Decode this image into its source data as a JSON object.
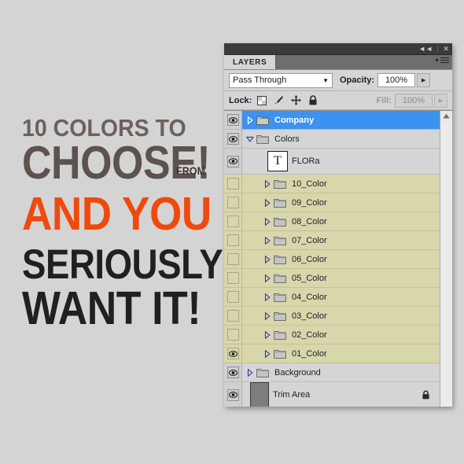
{
  "canvas": {
    "background_color": "#d4d4d4"
  },
  "poster": {
    "line1": "10 COLORS TO",
    "line2": "CHOOSE!",
    "line2_suffix": "FROM",
    "line3": "AND YOU",
    "line4": "SERIOUSLY",
    "line5": "WANT IT!",
    "colors": {
      "line1": "#6d615c",
      "line2": "#5d524e",
      "line2_suffix": "#3b3432",
      "line3": "#ef4a0e",
      "line4": "#211f1f",
      "line5": "#211f1f"
    }
  },
  "panel": {
    "titlebar": {
      "collapse_icon": "◄◄",
      "separator": "|",
      "close_icon": "✕"
    },
    "tab_label": "LAYERS",
    "menu_icon": "panel-menu-icon",
    "blend": {
      "mode": "Pass Through",
      "dropdown_arrow": "▼",
      "opacity_label": "Opacity:",
      "opacity_value": "100%",
      "stepper_arrow": "▶"
    },
    "lock": {
      "label": "Lock:",
      "icons": [
        "transparency-lock-icon",
        "brush-lock-icon",
        "move-lock-icon",
        "all-lock-icon"
      ],
      "fill_label": "Fill:",
      "fill_value": "100%",
      "fill_stepper_arrow": "▶"
    },
    "scrollbar": {
      "up_arrow": "▲"
    },
    "selected_row_color": "#3b92f0",
    "color_group_row_color": "#d8d6ab"
  },
  "layers": [
    {
      "name": "Company",
      "type": "group",
      "visible": true,
      "expanded": false,
      "selected": true,
      "indent": 0,
      "highlight": "selected"
    },
    {
      "name": "Colors",
      "type": "group",
      "visible": true,
      "expanded": true,
      "selected": false,
      "indent": 0,
      "highlight": "none"
    },
    {
      "name": "FLORa",
      "type": "text",
      "visible": true,
      "expanded": null,
      "selected": false,
      "indent": 1,
      "highlight": "none",
      "thumbnail": "T"
    },
    {
      "name": "10_Color",
      "type": "group",
      "visible": false,
      "expanded": false,
      "selected": false,
      "indent": 1,
      "highlight": "color"
    },
    {
      "name": "09_Color",
      "type": "group",
      "visible": false,
      "expanded": false,
      "selected": false,
      "indent": 1,
      "highlight": "color"
    },
    {
      "name": "08_Color",
      "type": "group",
      "visible": false,
      "expanded": false,
      "selected": false,
      "indent": 1,
      "highlight": "color"
    },
    {
      "name": "07_Color",
      "type": "group",
      "visible": false,
      "expanded": false,
      "selected": false,
      "indent": 1,
      "highlight": "color"
    },
    {
      "name": "06_Color",
      "type": "group",
      "visible": false,
      "expanded": false,
      "selected": false,
      "indent": 1,
      "highlight": "color"
    },
    {
      "name": "05_Color",
      "type": "group",
      "visible": false,
      "expanded": false,
      "selected": false,
      "indent": 1,
      "highlight": "color"
    },
    {
      "name": "04_Color",
      "type": "group",
      "visible": false,
      "expanded": false,
      "selected": false,
      "indent": 1,
      "highlight": "color"
    },
    {
      "name": "03_Color",
      "type": "group",
      "visible": false,
      "expanded": false,
      "selected": false,
      "indent": 1,
      "highlight": "color"
    },
    {
      "name": "02_Color",
      "type": "group",
      "visible": false,
      "expanded": false,
      "selected": false,
      "indent": 1,
      "highlight": "color"
    },
    {
      "name": "01_Color",
      "type": "group",
      "visible": true,
      "expanded": false,
      "selected": false,
      "indent": 1,
      "highlight": "color"
    },
    {
      "name": "Background",
      "type": "group",
      "visible": true,
      "expanded": false,
      "selected": false,
      "indent": 0,
      "highlight": "none"
    },
    {
      "name": "Trim Area",
      "type": "layer",
      "visible": true,
      "expanded": null,
      "selected": false,
      "indent": 0,
      "highlight": "none",
      "locked": true
    }
  ]
}
